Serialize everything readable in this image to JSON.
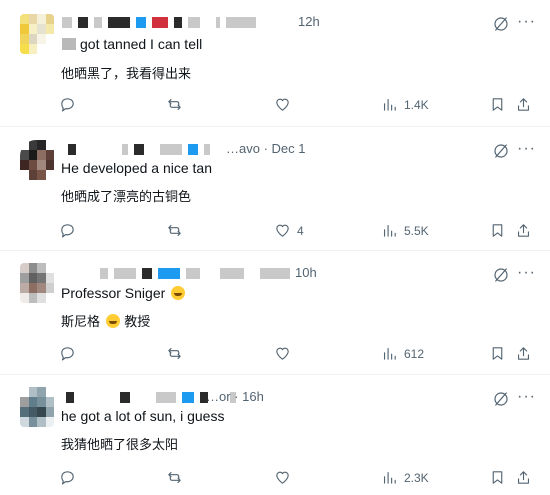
{
  "replies": [
    {
      "meta": "12h",
      "text_en": "got tanned I can tell",
      "text_zh": "他晒黑了，我看得出来",
      "emoji": false,
      "likes": "",
      "views": "1.4K"
    },
    {
      "meta": "…avo · Dec 1",
      "text_en": "He developed a nice tan",
      "text_zh": "他晒成了漂亮的古铜色",
      "emoji": false,
      "likes": "4",
      "views": "5.5K"
    },
    {
      "meta": "10h",
      "text_en": "Professor Sniger",
      "text_zh_a": "斯尼格",
      "text_zh_b": "教授",
      "emoji": true,
      "likes": "",
      "views": "612"
    },
    {
      "meta": "…or · 16h",
      "text_en": "he got a lot of sun, i guess",
      "text_zh": "我猜他晒了很多太阳",
      "emoji": false,
      "likes": "",
      "views": "2.3K"
    }
  ],
  "icons": {
    "reply": "reply-icon",
    "repost": "repost-icon",
    "like": "heart-icon",
    "views": "views-icon",
    "bookmark": "bookmark-icon",
    "share": "share-icon",
    "grok": "grok-icon"
  }
}
